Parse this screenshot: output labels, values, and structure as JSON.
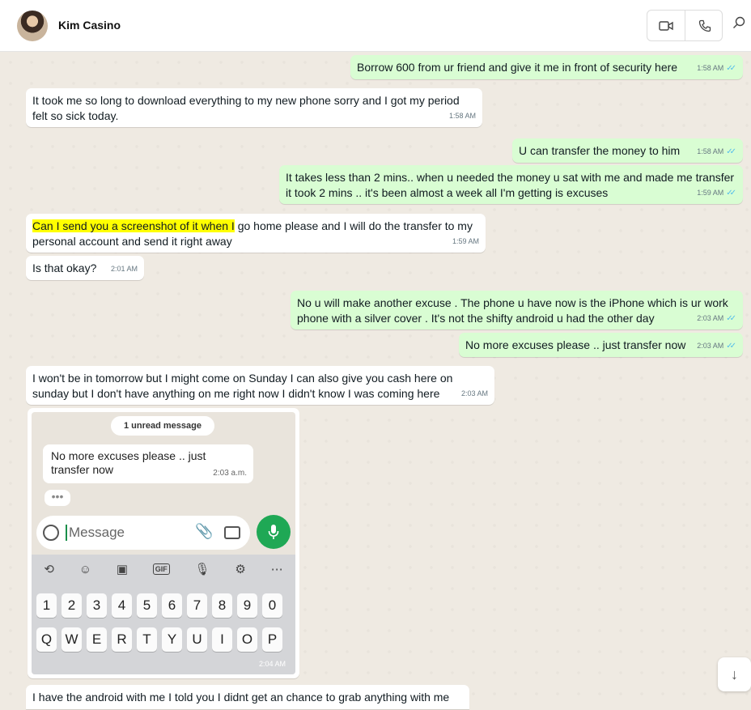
{
  "header": {
    "contact_name": "Kim Casino"
  },
  "messages": [
    {
      "dir": "out",
      "text": "Borrow 600 from ur friend and give it me in front of security here",
      "time": "1:58 AM"
    },
    {
      "dir": "in",
      "line1": "It took me so long to download everything to my new phone sorry and I got my period",
      "line2": "felt so sick today.",
      "time": "1:58 AM"
    },
    {
      "dir": "out",
      "text": "U can transfer the money to him",
      "time": "1:58 AM"
    },
    {
      "dir": "out",
      "line1": "It takes less than 2 mins.. when u needed the money u sat with me and made me transfer",
      "line2": "it took 2 mins .. it's been almost a week all I'm getting is excuses",
      "time": "1:59 AM"
    },
    {
      "dir": "in",
      "highlight": "Can I send you a screenshot of it when I",
      "rest": " go home please and I will do the transfer to my",
      "line2": "personal account and send it right away",
      "time": "1:59 AM"
    },
    {
      "dir": "in",
      "text": "Is that okay?",
      "time": "2:01 AM"
    },
    {
      "dir": "out",
      "line1": "No u will make another excuse .   The phone u have now is the iPhone which is ur work",
      "line2": "phone with a silver cover . It's not the shifty android u had the other day",
      "time": "2:03 AM"
    },
    {
      "dir": "out",
      "text": "No more excuses please .. just transfer now",
      "time": "2:03 AM"
    },
    {
      "dir": "in",
      "line1": "I won't be in tomorrow but I might come on Sunday I can also give you cash here on",
      "line2": "sunday but I don't have anything on me right now I didn't know I was coming here",
      "time": "2:03 AM"
    },
    {
      "dir": "in",
      "text": "I have the android with me I told you I didnt get an chance to grab anything with me"
    }
  ],
  "screenshot": {
    "unread_label": "1 unread message",
    "bubble_line1": "No more excuses please .. just",
    "bubble_line2": "transfer now",
    "bubble_time": "2:03 a.m.",
    "typing": "•••",
    "placeholder": "Message",
    "toolbar_gif": "GIF",
    "row_numbers": [
      "1",
      "2",
      "3",
      "4",
      "5",
      "6",
      "7",
      "8",
      "9",
      "0"
    ],
    "row_letters": [
      "Q",
      "W",
      "E",
      "R",
      "T",
      "Y",
      "U",
      "I",
      "O",
      "P"
    ],
    "time": "2:04 AM"
  },
  "icons": {
    "video": "video-camera-icon",
    "phone": "phone-icon",
    "search": "search-icon",
    "scroll": "arrow-down-icon"
  },
  "colors": {
    "outgoing": "#d9fdd3",
    "incoming": "#ffffff",
    "highlight": "#ffff00",
    "read_ticks": "#53bdeb"
  }
}
